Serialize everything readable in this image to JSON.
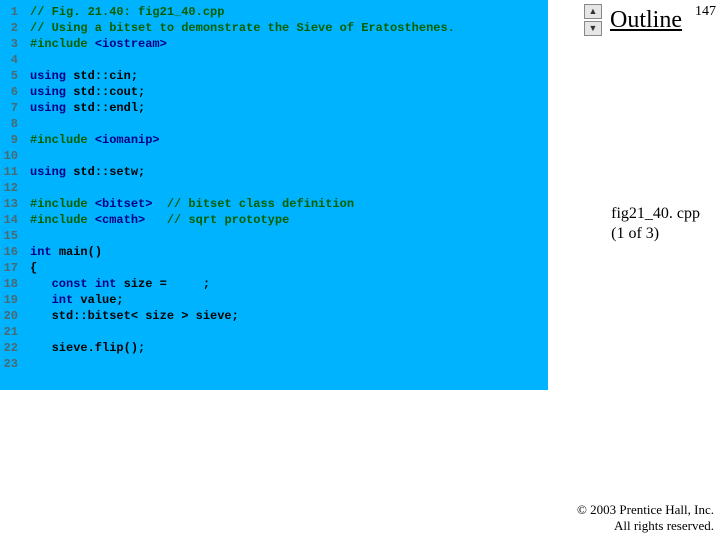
{
  "page_number": "147",
  "outline": {
    "label": "Outline"
  },
  "file_label": {
    "line1": "fig21_40. cpp",
    "line2": "(1 of 3)"
  },
  "copyright": {
    "line1": "© 2003 Prentice Hall, Inc.",
    "line2": "All rights reserved."
  },
  "scroll": {
    "up_glyph": "▲",
    "down_glyph": "▼"
  },
  "code": {
    "lines": [
      {
        "n": "1",
        "segs": [
          {
            "t": "// Fig. 21.40: fig21_40.cpp",
            "c": "cmt"
          }
        ]
      },
      {
        "n": "2",
        "segs": [
          {
            "t": "// Using a bitset to demonstrate the Sieve of Eratosthenes.",
            "c": "cmt"
          }
        ]
      },
      {
        "n": "3",
        "segs": [
          {
            "t": "#include ",
            "c": "pp"
          },
          {
            "t": "<iostream>",
            "c": "kw"
          }
        ]
      },
      {
        "n": "4",
        "segs": [
          {
            "t": "",
            "c": ""
          }
        ]
      },
      {
        "n": "5",
        "segs": [
          {
            "t": "using ",
            "c": "kw"
          },
          {
            "t": "std::cin;",
            "c": ""
          }
        ]
      },
      {
        "n": "6",
        "segs": [
          {
            "t": "using ",
            "c": "kw"
          },
          {
            "t": "std::cout;",
            "c": ""
          }
        ]
      },
      {
        "n": "7",
        "segs": [
          {
            "t": "using ",
            "c": "kw"
          },
          {
            "t": "std::endl;",
            "c": ""
          }
        ]
      },
      {
        "n": "8",
        "segs": [
          {
            "t": "",
            "c": ""
          }
        ]
      },
      {
        "n": "9",
        "segs": [
          {
            "t": "#include ",
            "c": "pp"
          },
          {
            "t": "<iomanip>",
            "c": "kw"
          }
        ]
      },
      {
        "n": "10",
        "segs": [
          {
            "t": "",
            "c": ""
          }
        ]
      },
      {
        "n": "11",
        "segs": [
          {
            "t": "using ",
            "c": "kw"
          },
          {
            "t": "std::setw;",
            "c": ""
          }
        ]
      },
      {
        "n": "12",
        "segs": [
          {
            "t": "",
            "c": ""
          }
        ]
      },
      {
        "n": "13",
        "segs": [
          {
            "t": "#include ",
            "c": "pp"
          },
          {
            "t": "<bitset>",
            "c": "kw"
          },
          {
            "t": "  ",
            "c": ""
          },
          {
            "t": "// bitset class definition",
            "c": "cmt"
          }
        ]
      },
      {
        "n": "14",
        "segs": [
          {
            "t": "#include ",
            "c": "pp"
          },
          {
            "t": "<cmath>",
            "c": "kw"
          },
          {
            "t": "   ",
            "c": ""
          },
          {
            "t": "// sqrt prototype",
            "c": "cmt"
          }
        ]
      },
      {
        "n": "15",
        "segs": [
          {
            "t": "",
            "c": ""
          }
        ]
      },
      {
        "n": "16",
        "segs": [
          {
            "t": "int ",
            "c": "kw"
          },
          {
            "t": "main()",
            "c": ""
          }
        ]
      },
      {
        "n": "17",
        "segs": [
          {
            "t": "{",
            "c": ""
          }
        ]
      },
      {
        "n": "18",
        "segs": [
          {
            "t": "   ",
            "c": ""
          },
          {
            "t": "const int ",
            "c": "kw"
          },
          {
            "t": "size =     ;",
            "c": ""
          }
        ]
      },
      {
        "n": "19",
        "segs": [
          {
            "t": "   ",
            "c": ""
          },
          {
            "t": "int ",
            "c": "kw"
          },
          {
            "t": "value;",
            "c": ""
          }
        ]
      },
      {
        "n": "20",
        "segs": [
          {
            "t": "   std::bitset< size > sieve;",
            "c": ""
          }
        ]
      },
      {
        "n": "21",
        "segs": [
          {
            "t": "",
            "c": ""
          }
        ]
      },
      {
        "n": "22",
        "segs": [
          {
            "t": "   sieve.flip();",
            "c": ""
          }
        ]
      },
      {
        "n": "23",
        "segs": [
          {
            "t": "",
            "c": ""
          }
        ]
      }
    ]
  }
}
